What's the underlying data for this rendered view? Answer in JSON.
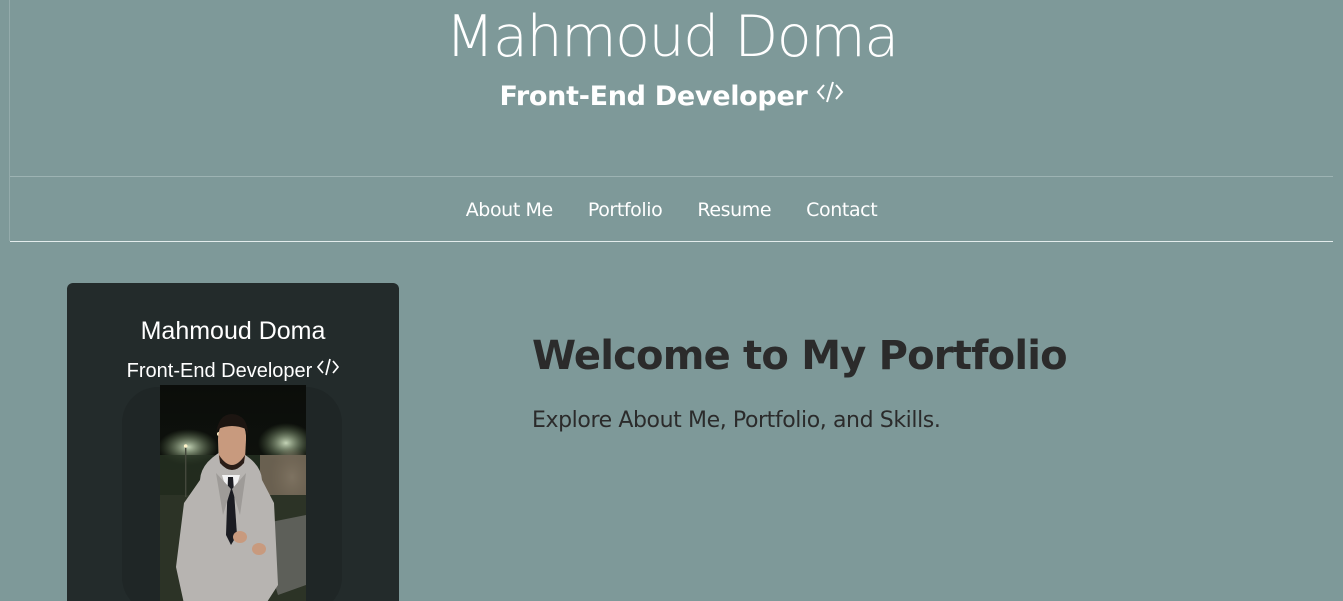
{
  "header": {
    "title": "Mahmoud Doma",
    "subtitle": "Front-End Developer"
  },
  "nav": {
    "items": [
      {
        "label": "About Me"
      },
      {
        "label": "Portfolio"
      },
      {
        "label": "Resume"
      },
      {
        "label": "Contact"
      }
    ]
  },
  "profile_card": {
    "name": "Mahmoud Doma",
    "role": "Front-End Developer",
    "photo_icon": "profile-photo"
  },
  "hero": {
    "title": "Welcome to My Portfolio",
    "text": "Explore About Me, Portfolio, and Skills."
  },
  "colors": {
    "background": "#7e9999",
    "card": "#232b2b",
    "header_text": "#ffffff",
    "body_text": "#2b2b2b"
  }
}
